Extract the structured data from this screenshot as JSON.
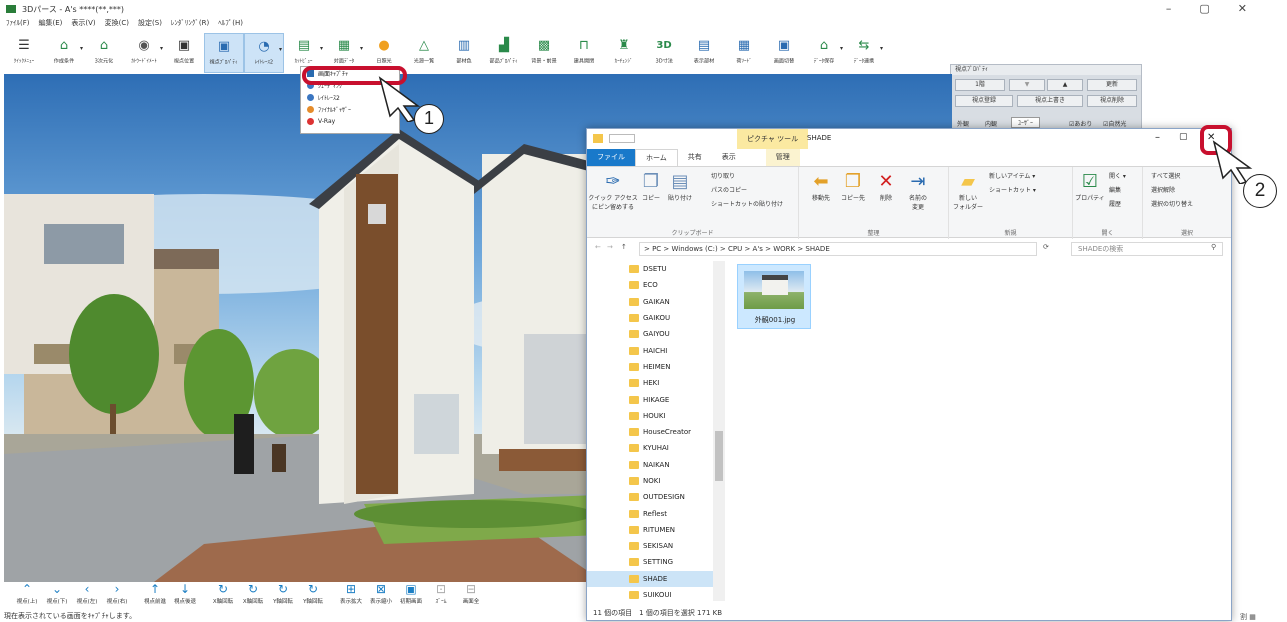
{
  "app": {
    "title": "3Dパース - A's ****(**,***)",
    "window_controls": [
      "–",
      "▢",
      "✕"
    ]
  },
  "menu": [
    "ﾌｧｲﾙ(F)",
    "編集(E)",
    "表示(V)",
    "変換(C)",
    "設定(S)",
    "ﾚﾝﾀﾞﾘﾝｸﾞ(R)",
    "ﾍﾙﾌﾟ(H)"
  ],
  "toolbar": [
    {
      "label": "ｸｲｯｸﾒﾆｭｰ",
      "icon": "menu-icon"
    },
    {
      "label": "作成条件",
      "icon": "conditions-icon"
    },
    {
      "label": "3次元化",
      "icon": "3d-icon"
    },
    {
      "label": "ｶﾄｳｰﾄﾞｲﾒｰﾄ",
      "icon": "walkthrough-icon"
    },
    {
      "label": "視点位置",
      "icon": "camera-icon"
    },
    {
      "label": "視点ﾌﾟﾛﾊﾟﾃｨ",
      "icon": "view-prop-icon"
    },
    {
      "label": "ﾚｲﾄﾚｰｽ2",
      "icon": "raytrace-icon"
    },
    {
      "label": "ｶｯﾄﾋﾞｭｰ",
      "icon": "cutview-icon"
    },
    {
      "label": "対面ﾃﾞｰﾀ",
      "icon": "facing-icon"
    },
    {
      "label": "日照光",
      "icon": "sun-icon"
    },
    {
      "label": "光源一覧",
      "icon": "light-icon"
    },
    {
      "label": "部材色",
      "icon": "color-icon"
    },
    {
      "label": "部品ﾌﾟﾛﾊﾟﾃｨ",
      "icon": "part-icon"
    },
    {
      "label": "背景・前景",
      "icon": "background-icon"
    },
    {
      "label": "建具開閉",
      "icon": "door-icon"
    },
    {
      "label": "ｶｰﾁｪﾝｼﾞ",
      "icon": "change-icon"
    },
    {
      "label": "3D寸法",
      "icon": "dimension-icon"
    },
    {
      "label": "表示部材",
      "icon": "display-icon"
    },
    {
      "label": "荷ｿｰﾄﾞ",
      "icon": "sort-icon"
    },
    {
      "label": "画面切替",
      "icon": "switch-icon"
    },
    {
      "label": "ﾃﾞｰﾀ保存",
      "icon": "save-icon"
    },
    {
      "label": "ﾃﾞｰﾀ連携",
      "icon": "link-icon"
    }
  ],
  "render_menu": {
    "items": [
      "画面ｷｬﾌﾟﾁｬ",
      "ｼｪｰﾃﾞｨﾝｸﾞ",
      "ﾚｲﾄﾚｰｽ2",
      "ﾌｧｲﾅﾙｷﾞｬｻﾞｰ",
      "V-Ray"
    ]
  },
  "view_props": {
    "title": "視点ﾌﾟﾛﾊﾟﾃｨ",
    "floor": "1階",
    "row1": [
      "▼",
      "▲",
      "更新"
    ],
    "row2": [
      "視点登録",
      "視点上書き",
      "視点削除"
    ],
    "row3": [
      "外観",
      "内観",
      "ﾕｰｻﾞｰ",
      "☑あおり",
      "☑自然光"
    ]
  },
  "callouts": [
    "1",
    "2"
  ],
  "explorer": {
    "context_tab": "ピクチャ ツール",
    "folder_title": "SHADE",
    "tabs": [
      "ファイル",
      "ホーム",
      "共有",
      "表示",
      "管理"
    ],
    "window_controls": [
      "–",
      "▢",
      "✕"
    ],
    "ribbon_groups": [
      "クリップボード",
      "整理",
      "新規",
      "開く",
      "選択"
    ],
    "ribbon": {
      "pin": "クイック アクセス\nにピン留めする",
      "copy": "コピー",
      "paste": "貼り付け",
      "cut": "切り取り",
      "copy_path": "パスのコピー",
      "paste_shortcut": "ショートカットの貼り付け",
      "move_to": "移動先",
      "copy_to": "コピー先",
      "delete": "削除",
      "rename": "名前の\n変更",
      "new_folder": "新しい\nフォルダー",
      "new_item": "新しいアイテム ▾",
      "shortcut": "ショートカット ▾",
      "properties": "プロパティ",
      "open": "開く ▾",
      "edit": "編集",
      "history": "履歴",
      "select_all": "すべて選択",
      "select_none": "選択解除",
      "invert": "選択の切り替え"
    },
    "breadcrumb": "> PC > Windows (C:) > CPU > A's > WORK > SHADE",
    "search_placeholder": "SHADEの検索",
    "folders": [
      "DSETU",
      "ECO",
      "GAIKAN",
      "GAIKOU",
      "GAIYOU",
      "HAICHI",
      "HEIMEN",
      "HEKI",
      "HIKAGE",
      "HOUKI",
      "HouseCreator",
      "KYUHAI",
      "NAIKAN",
      "NOKI",
      "OUTDESIGN",
      "Reflest",
      "RITUMEN",
      "SEKISAN",
      "SETTING",
      "SHADE",
      "SUIKOUI"
    ],
    "selected_folder": "SHADE",
    "file": {
      "name": "外観001.jpg"
    },
    "status": "11 個の項目　1 個の項目を選択 171 KB"
  },
  "bottom_nav": [
    {
      "label": "視点(上)",
      "icon": "up-icon"
    },
    {
      "label": "視点(下)",
      "icon": "down-icon"
    },
    {
      "label": "視点(左)",
      "icon": "left-icon"
    },
    {
      "label": "視点(右)",
      "icon": "right-icon"
    },
    {
      "label": "視点前進",
      "icon": "forward-icon"
    },
    {
      "label": "視点後退",
      "icon": "back-icon"
    },
    {
      "label": "X軸回転",
      "icon": "rotate-icon"
    },
    {
      "label": "X軸回転",
      "icon": "rotate-icon"
    },
    {
      "label": "Y軸回転",
      "icon": "rotate-icon"
    },
    {
      "label": "Y軸回転",
      "icon": "rotate-icon"
    },
    {
      "label": "表示拡大",
      "icon": "zoom-in-icon"
    },
    {
      "label": "表示縮小",
      "icon": "zoom-out-icon"
    },
    {
      "label": "初期画面",
      "icon": "home-icon"
    },
    {
      "label": "ｽﾞｰﾑ",
      "icon": "zoom-icon"
    },
    {
      "label": "画面全",
      "icon": "fit-icon"
    }
  ],
  "statusbar": {
    "text": "現在表示されている画面をｷｬﾌﾟﾁｬします。",
    "right": "割 ▦"
  },
  "colors": {
    "accent": "#1979ca",
    "highlight": "#c8102e",
    "sky": "#2e6eb5"
  }
}
